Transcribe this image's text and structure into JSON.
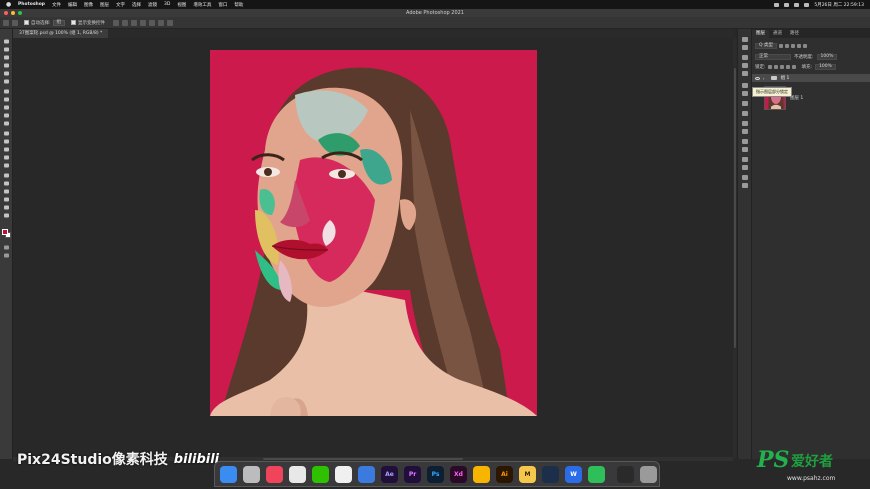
{
  "menubar": {
    "app": "Photoshop",
    "items": [
      "文件",
      "编辑",
      "图像",
      "图层",
      "文字",
      "选择",
      "滤镜",
      "3D",
      "视图",
      "增效工具",
      "窗口",
      "帮助"
    ],
    "clock": "5月26日 周二 22:59:13"
  },
  "window": {
    "title": "Adobe Photoshop 2021"
  },
  "options": {
    "auto_select": "自动选择:",
    "group": "组",
    "show_transform": "显示变换控件"
  },
  "document": {
    "tab": "37图案轮.psd @ 100% (组 1, RGB/8) *"
  },
  "layers": {
    "tabs": [
      "图层",
      "通道",
      "路径"
    ],
    "kind": "Q 类型",
    "mode": "正常",
    "opacity_label": "不透明度:",
    "opacity": "100%",
    "lock_label": "锁定:",
    "fill_label": "填充:",
    "fill": "100%",
    "group_name": "组 1",
    "layer_name": "图层 1",
    "tooltip": "指示图层部分锁定"
  },
  "watermark": {
    "left": "Pix24Studio像素科技",
    "bili": "bilibili",
    "ps": "PS",
    "cn": "爱好者",
    "url": "www.psahz.com"
  },
  "dock": {
    "icons": [
      "finder-icon",
      "launchpad-icon",
      "music-icon",
      "chrome-icon",
      "wechat-icon",
      "qq-icon",
      "browser-icon",
      "ae-icon",
      "pr-icon",
      "ps-icon",
      "xd-icon",
      "sketch-icon",
      "ai-icon",
      "m-icon",
      "c4d-icon",
      "w-icon",
      "c-icon",
      "bar-icon",
      "trash-icon"
    ],
    "labels": {
      "ae": "Ae",
      "pr": "Pr",
      "ps": "Ps",
      "xd": "Xd",
      "ai": "Ai",
      "m": "M",
      "w": "W"
    }
  },
  "colors": {
    "canvas_bg": "#c9184a",
    "accent_green": "#22b14c"
  }
}
